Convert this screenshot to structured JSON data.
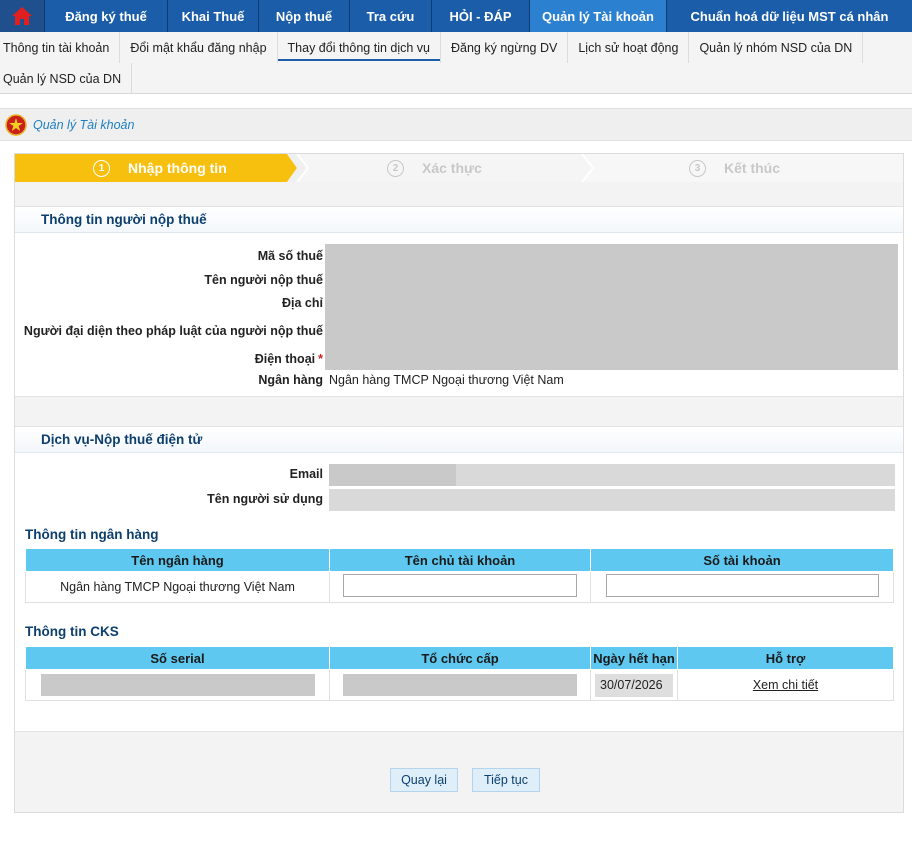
{
  "topnav": {
    "items": [
      "Đăng ký thuế",
      "Khai Thuế",
      "Nộp thuế",
      "Tra cứu",
      "HỎI - ĐÁP",
      "Quản lý Tài khoản",
      "Chuẩn hoá dữ liệu MST cá nhân"
    ],
    "active": "Quản lý Tài khoản",
    "colors": {
      "bar": "#1b5da8",
      "active": "#2c80d0",
      "home_icon": "#e02020"
    }
  },
  "subnav": {
    "items": [
      "Thông tin tài khoản",
      "Đổi mật khẩu đăng nhập",
      "Thay đổi thông tin dịch vụ",
      "Đăng ký ngừng DV",
      "Lịch sử hoạt động",
      "Quản lý nhóm NSD của DN",
      "Quản lý NSD của DN"
    ],
    "active": "Thay đổi thông tin dịch vụ"
  },
  "breadcrumb": {
    "text": "Quản lý Tài khoản"
  },
  "steps": [
    {
      "num": "1",
      "label": "Nhập thông tin",
      "state": "active"
    },
    {
      "num": "2",
      "label": "Xác thực",
      "state": "inactive"
    },
    {
      "num": "3",
      "label": "Kết thúc",
      "state": "inactive"
    }
  ],
  "taxpayer": {
    "title": "Thông tin người nộp thuế",
    "labels": {
      "tax_code": "Mã số thuế",
      "name": "Tên người nộp thuế",
      "address": "Địa chỉ",
      "representative": "Người đại diện theo pháp luật của người nộp thuế",
      "phone": "Điện thoại",
      "bank": "Ngân hàng"
    },
    "required_mark": "*",
    "bank_value": "Ngân hàng TMCP Ngoại thương Việt Nam"
  },
  "service": {
    "title": "Dịch vụ-Nộp thuế điện tử",
    "labels": {
      "email": "Email",
      "username": "Tên người sử dụng"
    }
  },
  "bank_info": {
    "title": "Thông tin ngân hàng",
    "headers": [
      "Tên ngân hàng",
      "Tên chủ tài khoản",
      "Số tài khoản"
    ],
    "row": {
      "bank_name": "Ngân hàng TMCP Ngoại thương Việt Nam",
      "account_holder": "",
      "account_number": ""
    }
  },
  "cks": {
    "title": "Thông tin CKS",
    "headers": [
      "Số serial",
      "Tổ chức cấp",
      "Ngày hết hạn",
      "Hỗ trợ"
    ],
    "row": {
      "expiry": "30/07/2026",
      "support_link": "Xem chi tiết"
    }
  },
  "buttons": {
    "back": "Quay lại",
    "next": "Tiếp tục"
  }
}
